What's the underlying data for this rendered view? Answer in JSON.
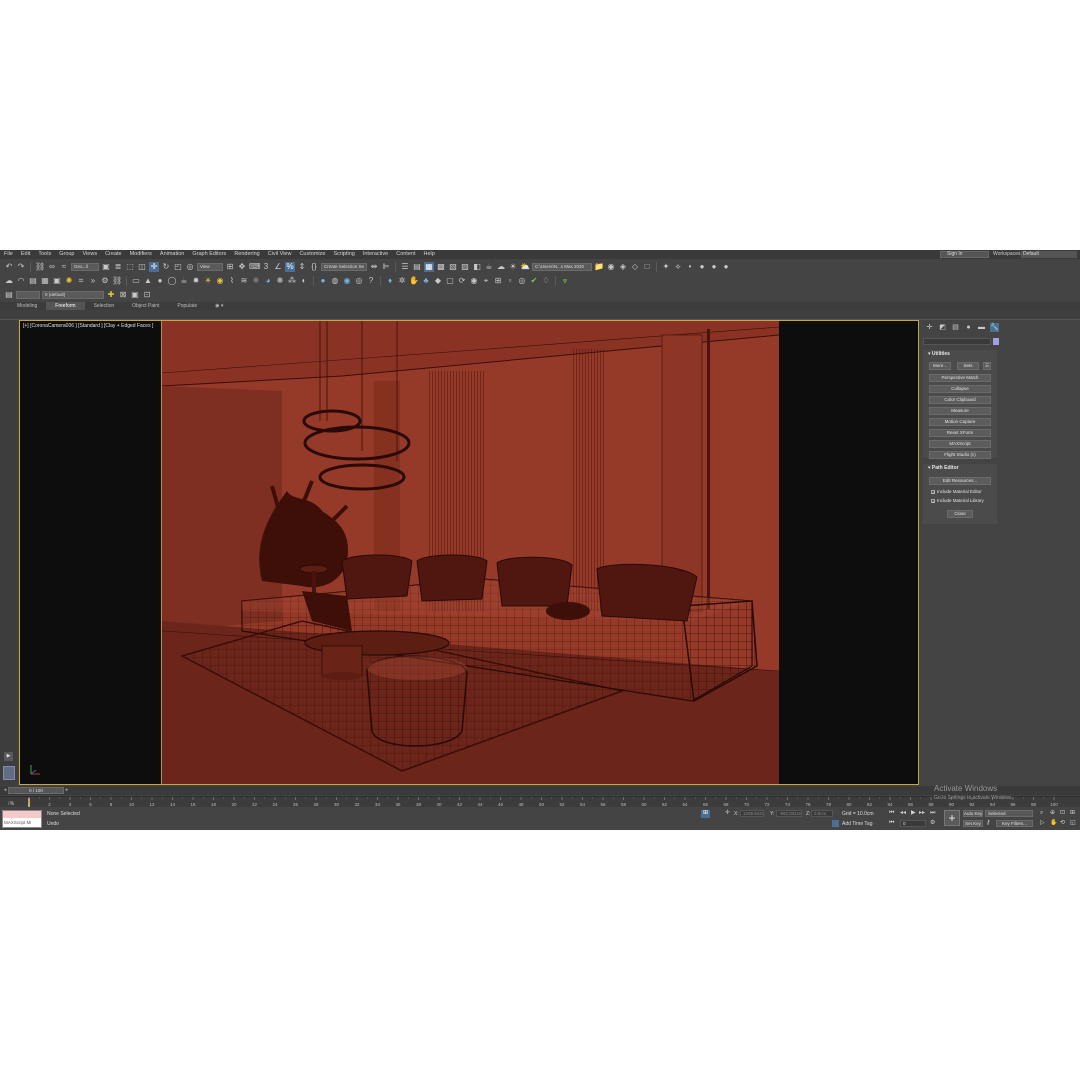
{
  "menu": [
    "File",
    "Edit",
    "Tools",
    "Group",
    "Views",
    "Create",
    "Modifiers",
    "Animation",
    "Graph Editors",
    "Rendering",
    "Civil View",
    "Customize",
    "Scripting",
    "Interactive",
    "Content",
    "Help"
  ],
  "signin": "Sign In",
  "workspaces_label": "Workspaces:",
  "workspaces_value": "Default",
  "toolbar1": {
    "reference_dropdown": "Geo...ll",
    "view_dropdown": "View",
    "selection_set": "Create Selection Se",
    "path_dropdown": "C:\\Users\\N...s Max 2020"
  },
  "toolbar3": {
    "layer": "0 (default)"
  },
  "ribbon_tabs": [
    "Modeling",
    "Freeform",
    "Selection",
    "Object Paint",
    "Populate"
  ],
  "viewport_label": "[+] [CoronaCamera006 ] [Standard ] [Clay + Edged Faces ]",
  "utilities": {
    "title": "Utilities",
    "more_button": "More...",
    "sets_button": "Sets",
    "items": [
      "Perspective Match",
      "Collapse",
      "Color Clipboard",
      "Measure",
      "Motion Capture",
      "Reset XForm",
      "MAXScript",
      "Flight Studio (c)"
    ]
  },
  "path_editor": {
    "title": "Path Editor",
    "edit_resources": "Edit Resources...",
    "include_material_editor": "Include Material Editor",
    "include_material_library": "Include Material Library",
    "close": "Close"
  },
  "timeslider": {
    "label": "0 / 100"
  },
  "ruler_ticks": [
    "0",
    "2",
    "4",
    "6",
    "8",
    "10",
    "12",
    "14",
    "16",
    "18",
    "20",
    "22",
    "24",
    "26",
    "28",
    "30",
    "32",
    "34",
    "36",
    "38",
    "40",
    "42",
    "44",
    "46",
    "48",
    "50",
    "52",
    "54",
    "56",
    "58",
    "60",
    "62",
    "64",
    "66",
    "68",
    "70",
    "72",
    "74",
    "76",
    "78",
    "80",
    "82",
    "84",
    "86",
    "88",
    "90",
    "92",
    "94",
    "96",
    "98",
    "100"
  ],
  "status": {
    "maxscript_label": "MAXScript Mi",
    "selection": "None Selected",
    "undo": "Undo",
    "x_label": "X:",
    "x_value": "1209.942cr",
    "y_label": "Y:",
    "y_value": "-992.041cm",
    "z_label": "Z:",
    "z_value": "0.0cm",
    "grid": "Grid = 10.0cm",
    "add_time_tag": "Add Time Tag",
    "auto_key": "Auto Key",
    "set_key": "Set Key",
    "selected": "Selected",
    "key_filters": "Key Filters...",
    "frame": "0"
  },
  "activate_windows": "Activate Windows",
  "activate_windows_sub": "Go to Settings to activate Windows."
}
